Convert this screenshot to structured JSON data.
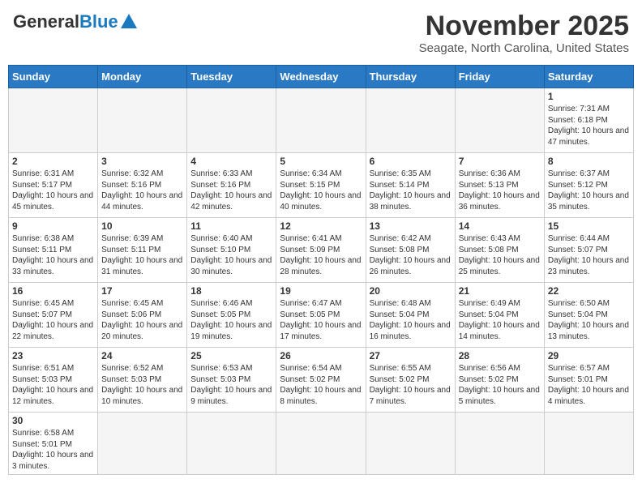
{
  "logo": {
    "general": "General",
    "blue": "Blue"
  },
  "title": "November 2025",
  "location": "Seagate, North Carolina, United States",
  "days_of_week": [
    "Sunday",
    "Monday",
    "Tuesday",
    "Wednesday",
    "Thursday",
    "Friday",
    "Saturday"
  ],
  "weeks": [
    [
      {
        "day": "",
        "info": ""
      },
      {
        "day": "",
        "info": ""
      },
      {
        "day": "",
        "info": ""
      },
      {
        "day": "",
        "info": ""
      },
      {
        "day": "",
        "info": ""
      },
      {
        "day": "",
        "info": ""
      },
      {
        "day": "1",
        "info": "Sunrise: 7:31 AM\nSunset: 6:18 PM\nDaylight: 10 hours and 47 minutes."
      }
    ],
    [
      {
        "day": "2",
        "info": "Sunrise: 6:31 AM\nSunset: 5:17 PM\nDaylight: 10 hours and 45 minutes."
      },
      {
        "day": "3",
        "info": "Sunrise: 6:32 AM\nSunset: 5:16 PM\nDaylight: 10 hours and 44 minutes."
      },
      {
        "day": "4",
        "info": "Sunrise: 6:33 AM\nSunset: 5:16 PM\nDaylight: 10 hours and 42 minutes."
      },
      {
        "day": "5",
        "info": "Sunrise: 6:34 AM\nSunset: 5:15 PM\nDaylight: 10 hours and 40 minutes."
      },
      {
        "day": "6",
        "info": "Sunrise: 6:35 AM\nSunset: 5:14 PM\nDaylight: 10 hours and 38 minutes."
      },
      {
        "day": "7",
        "info": "Sunrise: 6:36 AM\nSunset: 5:13 PM\nDaylight: 10 hours and 36 minutes."
      },
      {
        "day": "8",
        "info": "Sunrise: 6:37 AM\nSunset: 5:12 PM\nDaylight: 10 hours and 35 minutes."
      }
    ],
    [
      {
        "day": "9",
        "info": "Sunrise: 6:38 AM\nSunset: 5:11 PM\nDaylight: 10 hours and 33 minutes."
      },
      {
        "day": "10",
        "info": "Sunrise: 6:39 AM\nSunset: 5:11 PM\nDaylight: 10 hours and 31 minutes."
      },
      {
        "day": "11",
        "info": "Sunrise: 6:40 AM\nSunset: 5:10 PM\nDaylight: 10 hours and 30 minutes."
      },
      {
        "day": "12",
        "info": "Sunrise: 6:41 AM\nSunset: 5:09 PM\nDaylight: 10 hours and 28 minutes."
      },
      {
        "day": "13",
        "info": "Sunrise: 6:42 AM\nSunset: 5:08 PM\nDaylight: 10 hours and 26 minutes."
      },
      {
        "day": "14",
        "info": "Sunrise: 6:43 AM\nSunset: 5:08 PM\nDaylight: 10 hours and 25 minutes."
      },
      {
        "day": "15",
        "info": "Sunrise: 6:44 AM\nSunset: 5:07 PM\nDaylight: 10 hours and 23 minutes."
      }
    ],
    [
      {
        "day": "16",
        "info": "Sunrise: 6:45 AM\nSunset: 5:07 PM\nDaylight: 10 hours and 22 minutes."
      },
      {
        "day": "17",
        "info": "Sunrise: 6:45 AM\nSunset: 5:06 PM\nDaylight: 10 hours and 20 minutes."
      },
      {
        "day": "18",
        "info": "Sunrise: 6:46 AM\nSunset: 5:05 PM\nDaylight: 10 hours and 19 minutes."
      },
      {
        "day": "19",
        "info": "Sunrise: 6:47 AM\nSunset: 5:05 PM\nDaylight: 10 hours and 17 minutes."
      },
      {
        "day": "20",
        "info": "Sunrise: 6:48 AM\nSunset: 5:04 PM\nDaylight: 10 hours and 16 minutes."
      },
      {
        "day": "21",
        "info": "Sunrise: 6:49 AM\nSunset: 5:04 PM\nDaylight: 10 hours and 14 minutes."
      },
      {
        "day": "22",
        "info": "Sunrise: 6:50 AM\nSunset: 5:04 PM\nDaylight: 10 hours and 13 minutes."
      }
    ],
    [
      {
        "day": "23",
        "info": "Sunrise: 6:51 AM\nSunset: 5:03 PM\nDaylight: 10 hours and 12 minutes."
      },
      {
        "day": "24",
        "info": "Sunrise: 6:52 AM\nSunset: 5:03 PM\nDaylight: 10 hours and 10 minutes."
      },
      {
        "day": "25",
        "info": "Sunrise: 6:53 AM\nSunset: 5:03 PM\nDaylight: 10 hours and 9 minutes."
      },
      {
        "day": "26",
        "info": "Sunrise: 6:54 AM\nSunset: 5:02 PM\nDaylight: 10 hours and 8 minutes."
      },
      {
        "day": "27",
        "info": "Sunrise: 6:55 AM\nSunset: 5:02 PM\nDaylight: 10 hours and 7 minutes."
      },
      {
        "day": "28",
        "info": "Sunrise: 6:56 AM\nSunset: 5:02 PM\nDaylight: 10 hours and 5 minutes."
      },
      {
        "day": "29",
        "info": "Sunrise: 6:57 AM\nSunset: 5:01 PM\nDaylight: 10 hours and 4 minutes."
      }
    ],
    [
      {
        "day": "30",
        "info": "Sunrise: 6:58 AM\nSunset: 5:01 PM\nDaylight: 10 hours and 3 minutes."
      },
      {
        "day": "",
        "info": ""
      },
      {
        "day": "",
        "info": ""
      },
      {
        "day": "",
        "info": ""
      },
      {
        "day": "",
        "info": ""
      },
      {
        "day": "",
        "info": ""
      },
      {
        "day": "",
        "info": ""
      }
    ]
  ]
}
